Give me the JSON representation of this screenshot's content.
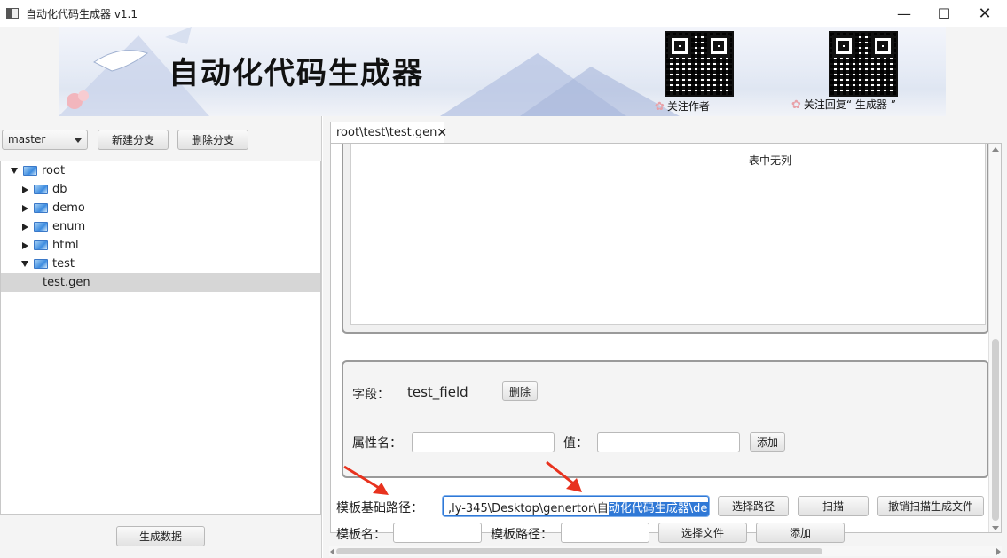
{
  "window": {
    "title": "自动化代码生成器 v1.1",
    "controls": [
      "minimize-icon",
      "maximize-icon",
      "close-icon"
    ]
  },
  "banner": {
    "title": "自动化代码生成器",
    "qr_captions": [
      "关注作者",
      "关注回复“ 生成器 ”"
    ]
  },
  "left": {
    "branch_select": "master",
    "new_branch_label": "新建分支",
    "delete_branch_label": "删除分支",
    "tree": [
      {
        "label": "root",
        "expanded": true,
        "depth": 0
      },
      {
        "label": "db",
        "expanded": false,
        "depth": 1
      },
      {
        "label": "demo",
        "expanded": false,
        "depth": 1
      },
      {
        "label": "enum",
        "expanded": false,
        "depth": 1
      },
      {
        "label": "html",
        "expanded": false,
        "depth": 1
      },
      {
        "label": "test",
        "expanded": true,
        "depth": 1
      },
      {
        "label": "test.gen",
        "leaf": true,
        "selected": true,
        "depth": 2
      }
    ],
    "generate_label": "生成数据"
  },
  "editor": {
    "tab_label": "root\\test\\test.gen",
    "empty_table_msg": "表中无列",
    "field_label": "字段：",
    "field_value": "test_field",
    "delete_label": "删除",
    "attr_name_label": "属性名：",
    "value_label": "值：",
    "add_label": "添加"
  },
  "bottom": {
    "template_base_path_label": "模板基础路径：",
    "template_base_path_prefix": ",ly-345\\Desktop\\genertor\\自",
    "template_base_path_selected": "动化代码生成器\\demo",
    "choose_path_label": "选择路径",
    "scan_label": "扫描",
    "undo_scan_label": "撤销扫描生成文件",
    "template_name_label": "模板名：",
    "template_path_label": "模板路径：",
    "choose_file_label": "选择文件",
    "add_label": "添加"
  },
  "colors": {
    "selection": "#2f78d6",
    "annotation_arrow": "#e8321e",
    "tree_selected": "#d6d6d6"
  }
}
